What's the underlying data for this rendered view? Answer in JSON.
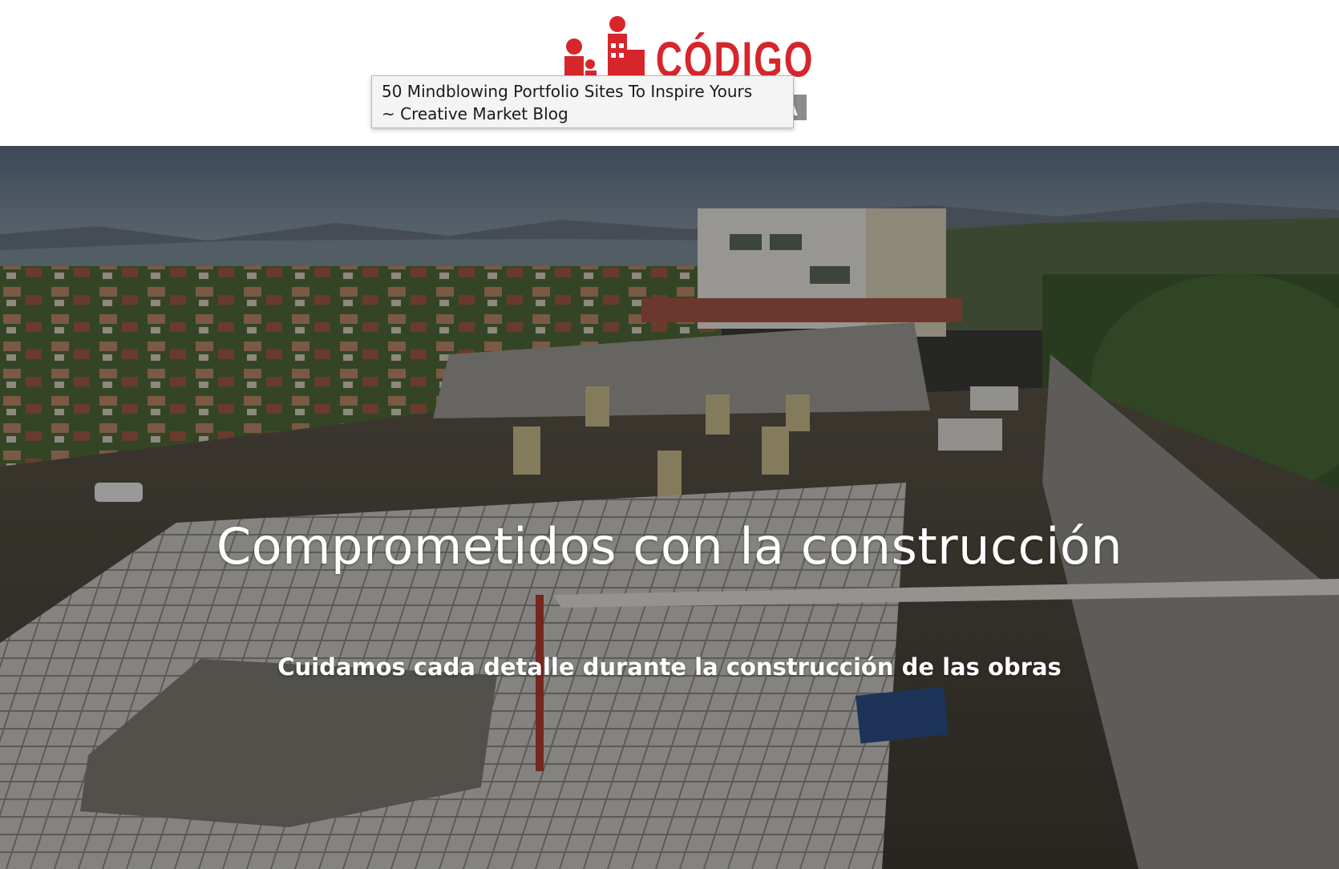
{
  "header": {
    "logo": {
      "icon": "building-logo-icon",
      "wordmark": "CÓDIGO UB",
      "badge_letter": "A",
      "brand_color": "#d6262c",
      "badge_color": "#8c8c8c"
    }
  },
  "tooltip": {
    "line1": "50 Mindblowing Portfolio Sites To Inspire Yours",
    "line2": "~ Creative Market Blog"
  },
  "hero": {
    "title": "Comprometidos con la construcción",
    "subtitle": "Cuidamos cada detalle durante la construcción de las obras",
    "background": "aerial-construction-site-photo",
    "text_color": "#ffffff"
  }
}
